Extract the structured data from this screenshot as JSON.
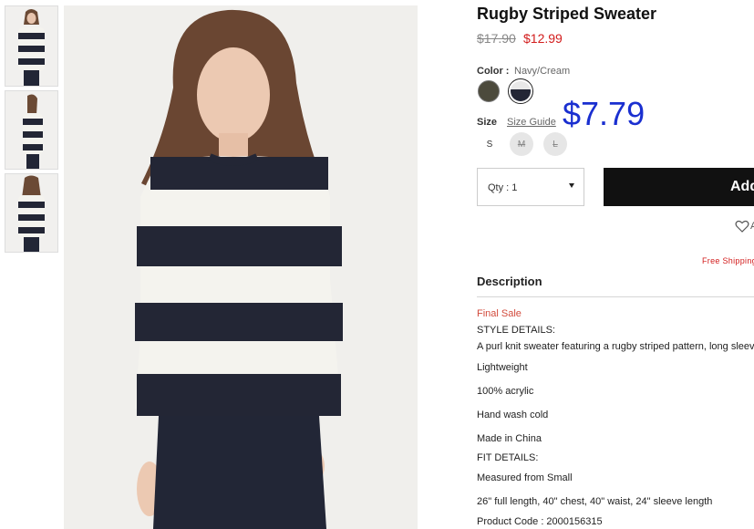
{
  "gallery": {
    "thumbnails": [
      {
        "view": "front"
      },
      {
        "view": "side"
      },
      {
        "view": "back"
      }
    ],
    "main_image": {
      "description": "model-front"
    }
  },
  "product": {
    "title": "Rugby Striped Sweater",
    "original_price": "$17.90",
    "sale_price": "$12.99",
    "overlay_price": "$7.79",
    "color_label": "Color :",
    "color_value": "Navy/Cream",
    "swatches": [
      {
        "name": "Olive",
        "color": "#4c4a3c"
      },
      {
        "name": "Navy/Cream",
        "color": "#232635"
      }
    ],
    "size_label": "Size",
    "size_guide": "Size Guide",
    "sizes": [
      {
        "label": "S",
        "available": true
      },
      {
        "label": "M",
        "available": false
      },
      {
        "label": "L",
        "available": false
      }
    ],
    "qty_label": "Qty : 1",
    "add_button": "Add",
    "wishlist_text": "A",
    "free_shipping": "Free Shipping"
  },
  "description": {
    "heading": "Description",
    "final_sale": "Final Sale",
    "lines": [
      "STYLE DETAILS:",
      "A purl knit sweater featuring a rugby striped pattern, long sleeves",
      "Lightweight",
      "100% acrylic",
      "Hand wash cold",
      "Made in China",
      "FIT DETAILS:",
      "Measured from Small",
      "26\" full length, 40\" chest, 40\" waist, 24\" sleeve length",
      "Product Code : 2000156315"
    ]
  },
  "colors": {
    "accent_red": "#d21c1c",
    "overlay_blue": "#1a2fd0",
    "button_black": "#111111",
    "sweater_navy": "#232635",
    "sweater_cream": "#f4f3ee"
  }
}
